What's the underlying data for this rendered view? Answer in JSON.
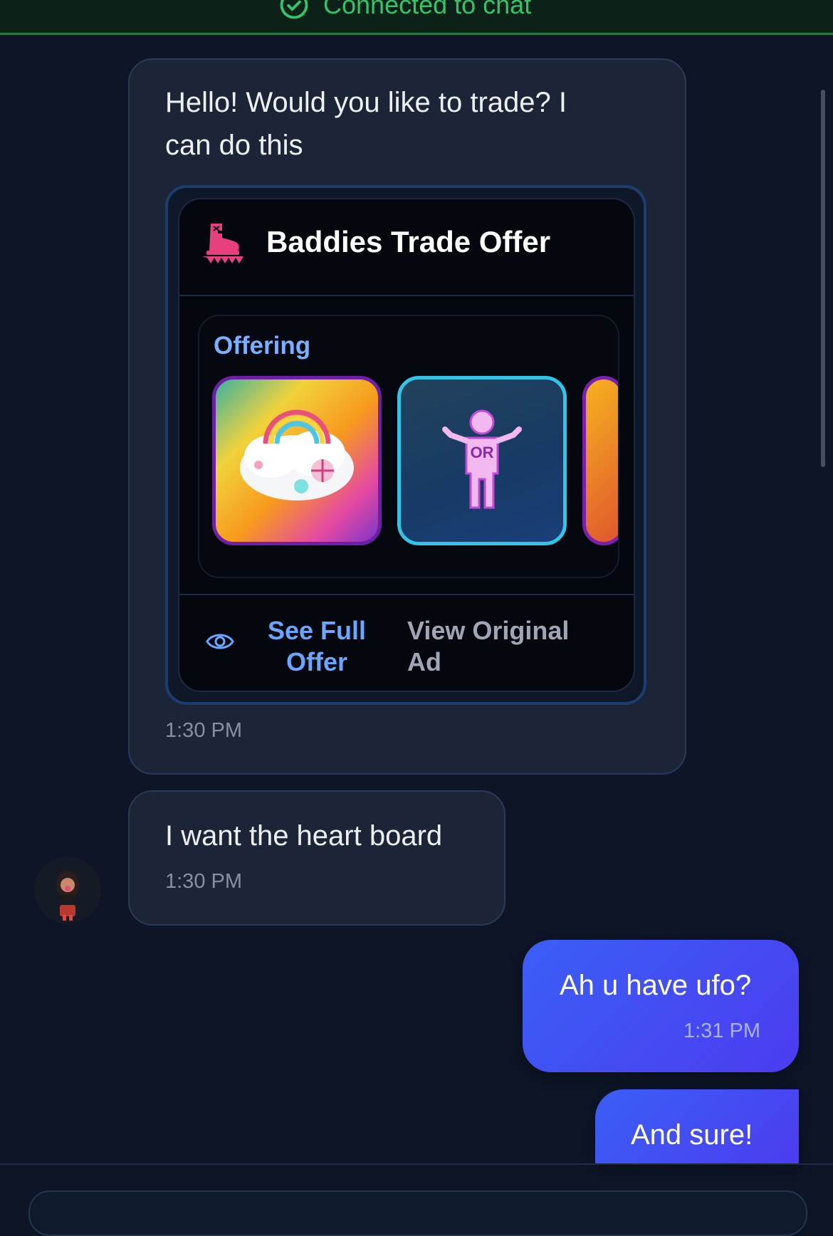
{
  "status": {
    "text": "Connected to chat"
  },
  "messages": {
    "m1": {
      "text": "Hello! Would you like to trade? I can do this",
      "time": "1:30 PM",
      "offer": {
        "title": "Baddies Trade Offer",
        "section_label": "Offering",
        "items": [
          {
            "icon": "rainbow-cloud-item-icon"
          },
          {
            "icon": "or-person-item-icon",
            "label": "OR"
          },
          {
            "icon": "partial-item-icon"
          }
        ],
        "see_full": "See Full Offer",
        "view_original": "View Original Ad"
      }
    },
    "m2": {
      "text": "I want the heart board",
      "time": "1:30 PM"
    },
    "m3": {
      "text": "Ah u have ufo?",
      "time": "1:31 PM"
    },
    "m4": {
      "text": "And sure!"
    }
  },
  "colors": {
    "accent_blue": "#3a5ff5",
    "connected_green": "#34c369",
    "link_blue": "#6aa6ff"
  }
}
